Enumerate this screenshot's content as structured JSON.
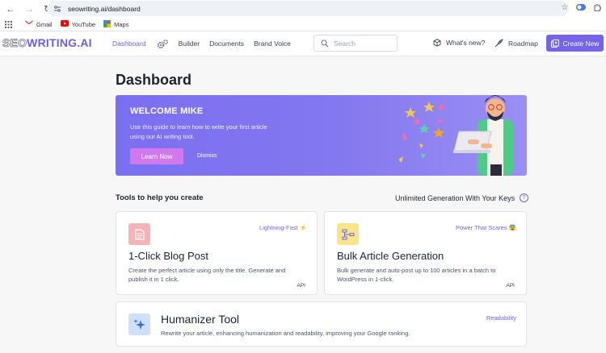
{
  "browser": {
    "url": "seowriting.ai/dashboard",
    "bookmarks": [
      "Gmail",
      "YouTube",
      "Maps"
    ]
  },
  "header": {
    "logo_part1": "SEO",
    "logo_part2": "WRITING.AI",
    "nav": [
      "Dashboard",
      "Builder",
      "Documents",
      "Brand Voice"
    ],
    "search_placeholder": "Search",
    "whats_new": "What's new?",
    "roadmap": "Roadmap",
    "create_new": "Create New"
  },
  "page": {
    "title": "Dashboard"
  },
  "banner": {
    "title": "WELCOME MIKE",
    "text": "Use this guide to learn how to write your first article using our AI writing tool.",
    "learn_now": "Learn Now",
    "dismiss": "Dismiss"
  },
  "tools": {
    "heading": "Tools to help you create",
    "unlimited": "Unlimited Generation With Your Keys",
    "help": "?",
    "cards": [
      {
        "tag": "Lightning-Fast ⚡",
        "title": "1-Click Blog Post",
        "desc": "Create the perfect article using only the title. Generate and publish it in 1 click.",
        "api": "API"
      },
      {
        "tag": "Power That Scares 😨",
        "title": "Bulk Article Generation",
        "desc": "Bulk generate and auto-post up to 100 articles in a batch to WordPress in 1-click.",
        "api": "API"
      },
      {
        "tag": "Readability",
        "title": "Humanizer Tool",
        "desc": "Rewrite your article, enhancing humanization and readability, improving your Google ranking."
      }
    ]
  },
  "colors": {
    "accent": "#7563ea",
    "banner": "#8478ef",
    "learn_button": "#d078ec"
  }
}
